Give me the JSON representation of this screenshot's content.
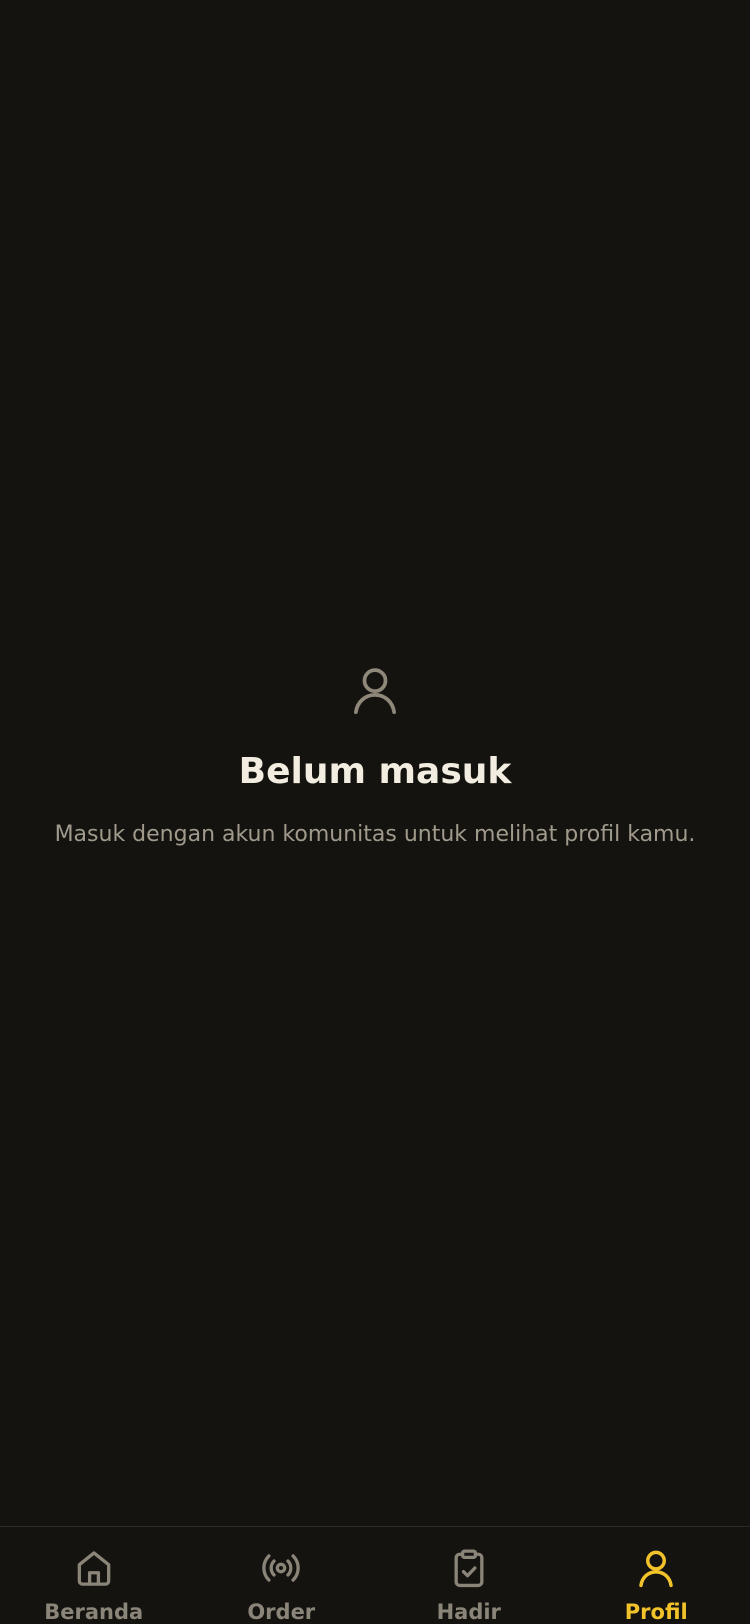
{
  "empty_state": {
    "icon": "user-icon",
    "title": "Belum masuk",
    "message": "Masuk dengan akun komunitas untuk melihat profil kamu."
  },
  "tabbar": {
    "active_tab": "Profil",
    "items": [
      {
        "label": "Beranda",
        "icon": "home-icon"
      },
      {
        "label": "Order",
        "icon": "broadcast-icon"
      },
      {
        "label": "Hadir",
        "icon": "clipboard-check-icon"
      },
      {
        "label": "Profil",
        "icon": "user-icon"
      }
    ]
  },
  "colors": {
    "background": "#14130f",
    "title_text": "#f2ede0",
    "muted_text": "#a09a8c",
    "inactive_tab": "#8a8578",
    "accent": "#f2c22a"
  }
}
